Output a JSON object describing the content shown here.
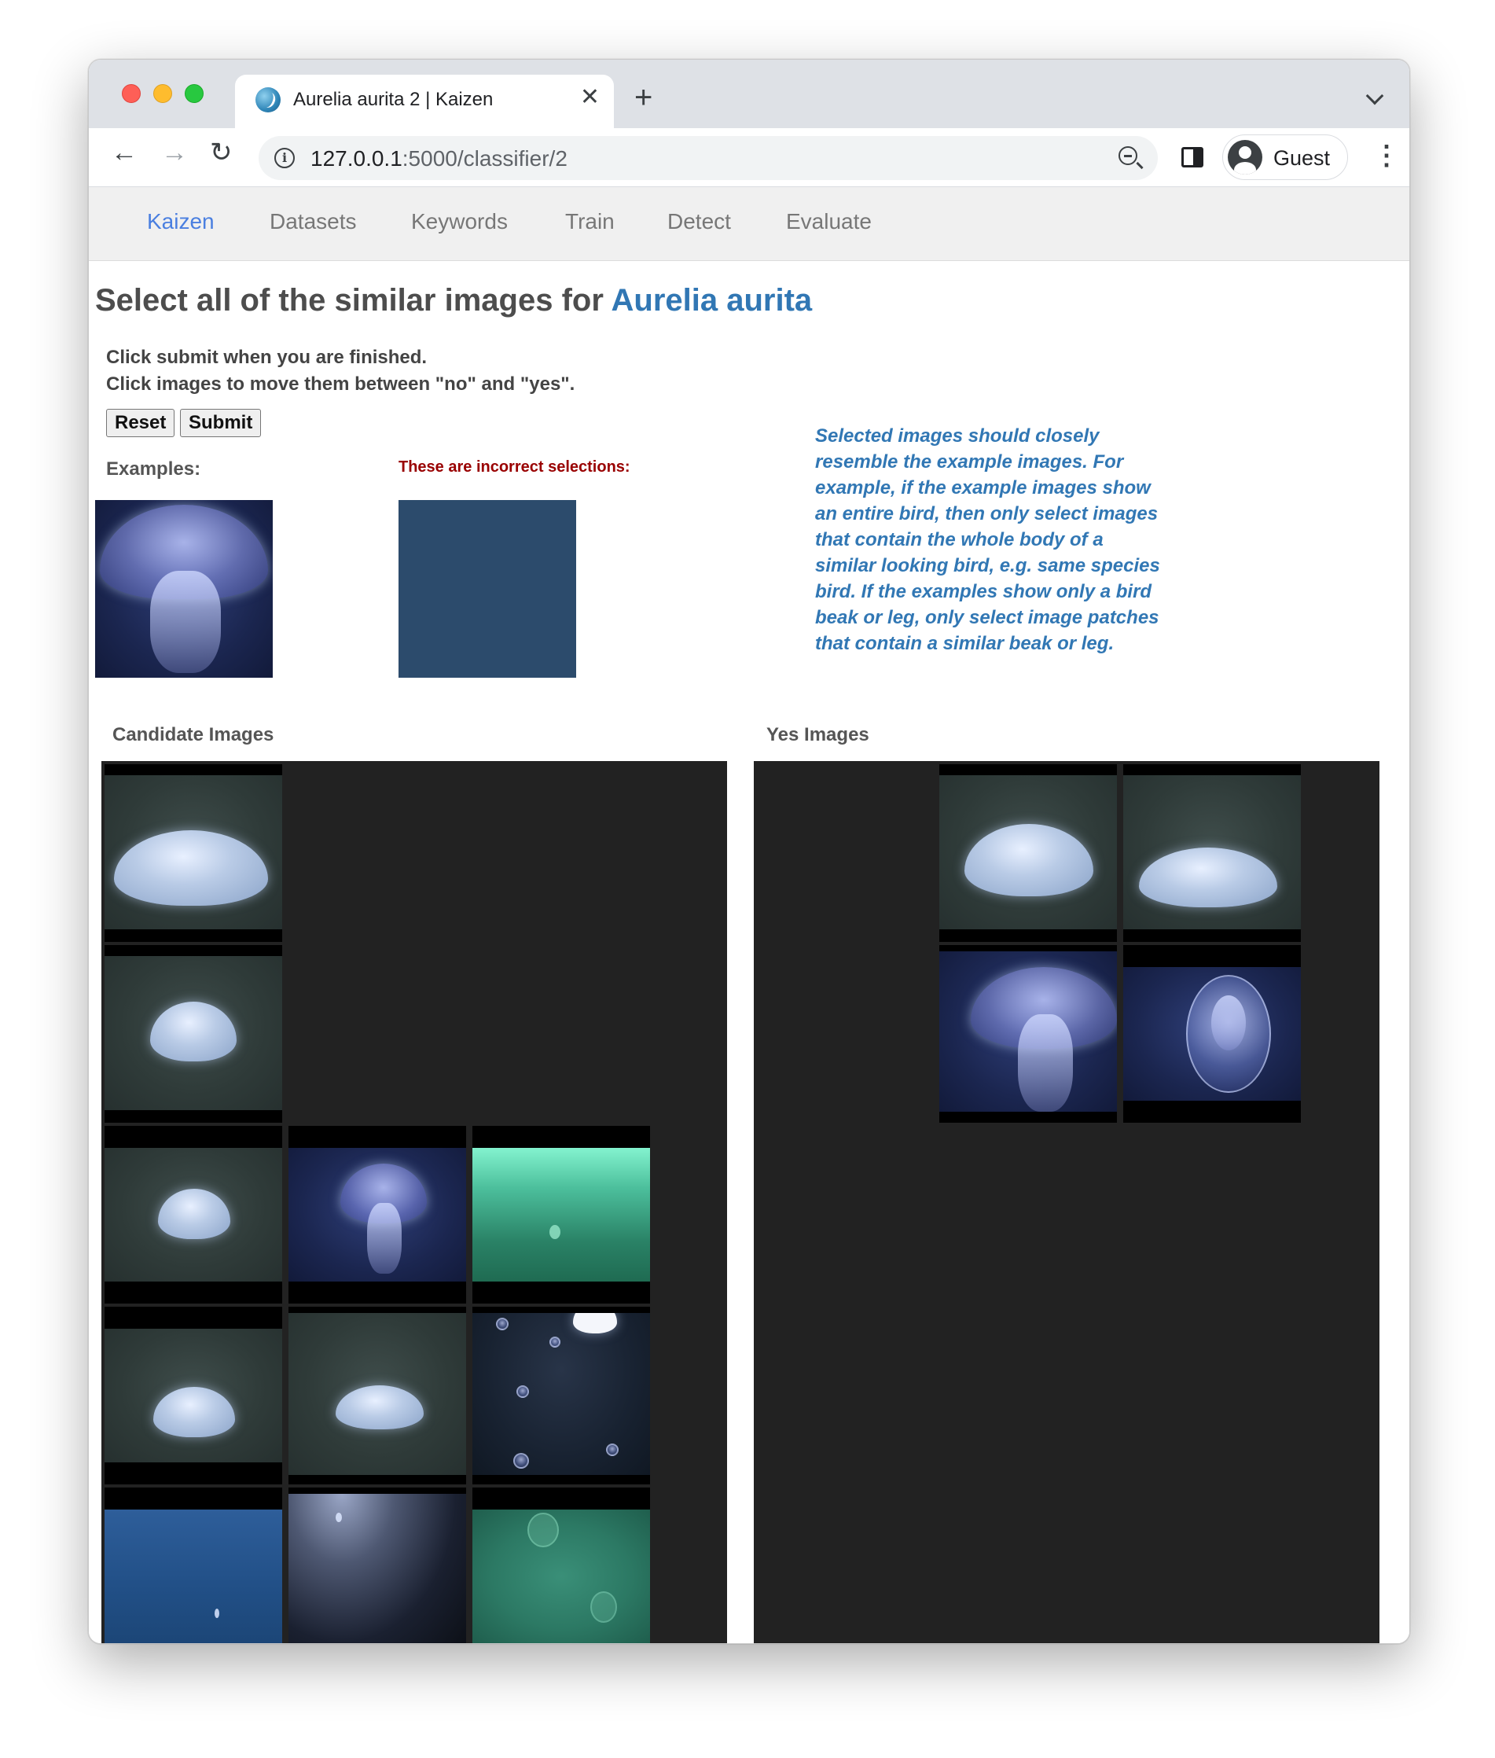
{
  "browser": {
    "tab_title": "Aurelia aurita 2 | Kaizen",
    "tab_close": "✕",
    "new_tab": "+",
    "url_host": "127.0.0.1",
    "url_path": ":5000/classifier/2",
    "profile_label": "Guest",
    "nav_back": "←",
    "nav_forward": "→",
    "nav_reload": "↻",
    "menu": "⋮",
    "info": "i"
  },
  "navbar": {
    "brand": "Kaizen",
    "links": [
      "Datasets",
      "Keywords",
      "Train",
      "Detect",
      "Evaluate"
    ]
  },
  "heading": {
    "prefix": "Select all of the similar images for ",
    "species": "Aurelia aurita"
  },
  "instructions": {
    "line1": "Click submit when you are finished.",
    "line2": "Click images to move them between \"no\" and \"yes\"."
  },
  "buttons": {
    "reset": "Reset",
    "submit": "Submit"
  },
  "labels": {
    "examples": "Examples:",
    "incorrect": "These are incorrect selections:",
    "candidate": "Candidate Images",
    "yes": "Yes Images"
  },
  "guidance": "Selected images should closely resemble the example images. For example, if the example images show an entire bird, then only select images that contain the whole body of a similar looking bird, e.g. same species bird. If the examples show only a bird beak or leg, only select image patches that contain a similar beak or leg.",
  "colors": {
    "accent": "#3177b4",
    "brand": "#4a7fe0",
    "error": "#990000",
    "panel": "#222222"
  }
}
